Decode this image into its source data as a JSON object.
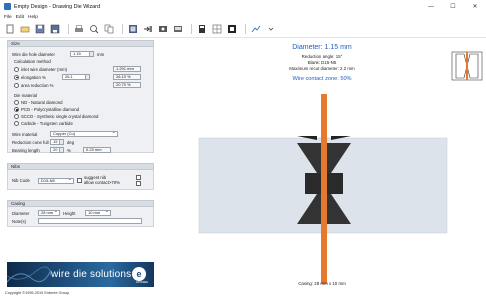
{
  "window": {
    "title": "Empty Design - Drawing Die Wizard",
    "minimize": "—",
    "maximize": "☐",
    "close": "✕"
  },
  "menu": {
    "file": "File",
    "edit": "Edit",
    "help": "Help"
  },
  "toolbar": {
    "icons": [
      "new-icon",
      "open-icon",
      "save-icon",
      "save-as-icon",
      "print-icon",
      "print-preview-icon",
      "copy-icon",
      "export-icon",
      "import-icon",
      "settings-icon",
      "view-icon",
      "tool-icon",
      "help-icon",
      "info-icon"
    ]
  },
  "size_section": {
    "header": "Size",
    "wire_die_hole_diameter_label": "Wire die hole diameter",
    "wire_die_hole_diameter_value": "1.15",
    "wire_die_hole_diameter_unit": "mm",
    "calc_method_label": "Calculation method",
    "inlet_wire_diameter_label": "inlet wire diameter (mm)",
    "inlet_wire_diameter_value": "1.291 mm",
    "elongation_label": "elongation %",
    "elongation_value": "26.1",
    "elongation_result": "26.10 %",
    "area_reduction_label": "area reduction %",
    "area_reduction_result": "20.70 %"
  },
  "die_material": {
    "label": "Die material",
    "options": [
      "ND - Natural diamond",
      "PCD - Polycrystalline diamond",
      "SCCD - Synthetic single crystal diamond",
      "Carbide - Tungsten carbide"
    ],
    "selected_index": 1
  },
  "wire_material": {
    "label": "Wire material",
    "value": "Copper (Cu)",
    "reduction_cone_label": "Reduction cone full angle",
    "reduction_cone_value": "15",
    "reduction_cone_unit": "deg",
    "bearing_length_label": "Bearing length",
    "bearing_length_value": "20",
    "bearing_length_unit": "%",
    "bearing_length_result": "0.23 mm"
  },
  "nibs": {
    "header": "Nibs",
    "nib_code_label": "Nib Code",
    "nib_code_value": "D15-N5",
    "suggest_nib_label": "suggest nib",
    "allow_contact_label": "allow contact>70%"
  },
  "casing": {
    "header": "Casing",
    "diameter_label": "Diameter",
    "diameter_value": "28 mm",
    "height_label": "Height",
    "height_value": "10 mm",
    "notes_label": "Note(s)",
    "notes_value": ""
  },
  "banner": {
    "text": "wire die solutions",
    "logo_letter": "e",
    "logo_sub": "ENTEREE"
  },
  "copyright": "Copyright ©1999-2019 Enteree Group",
  "drawing": {
    "diameter_title": "Diameter: 1.15 mm",
    "reduction_angle": "Reduction angle: 15°",
    "blank": "Blank: D15-N5",
    "max_recut": "Maximum recut diameter: 2.2 mm",
    "contact_zone": "Wire contact zone: 50%",
    "casing_label": "Casing: 28 mm x 10 mm",
    "colors": {
      "title_blue": "#1f5fbf",
      "wire_orange": "#e6792e",
      "casing_gray": "#dce3ea",
      "nib_black": "#222222"
    }
  }
}
